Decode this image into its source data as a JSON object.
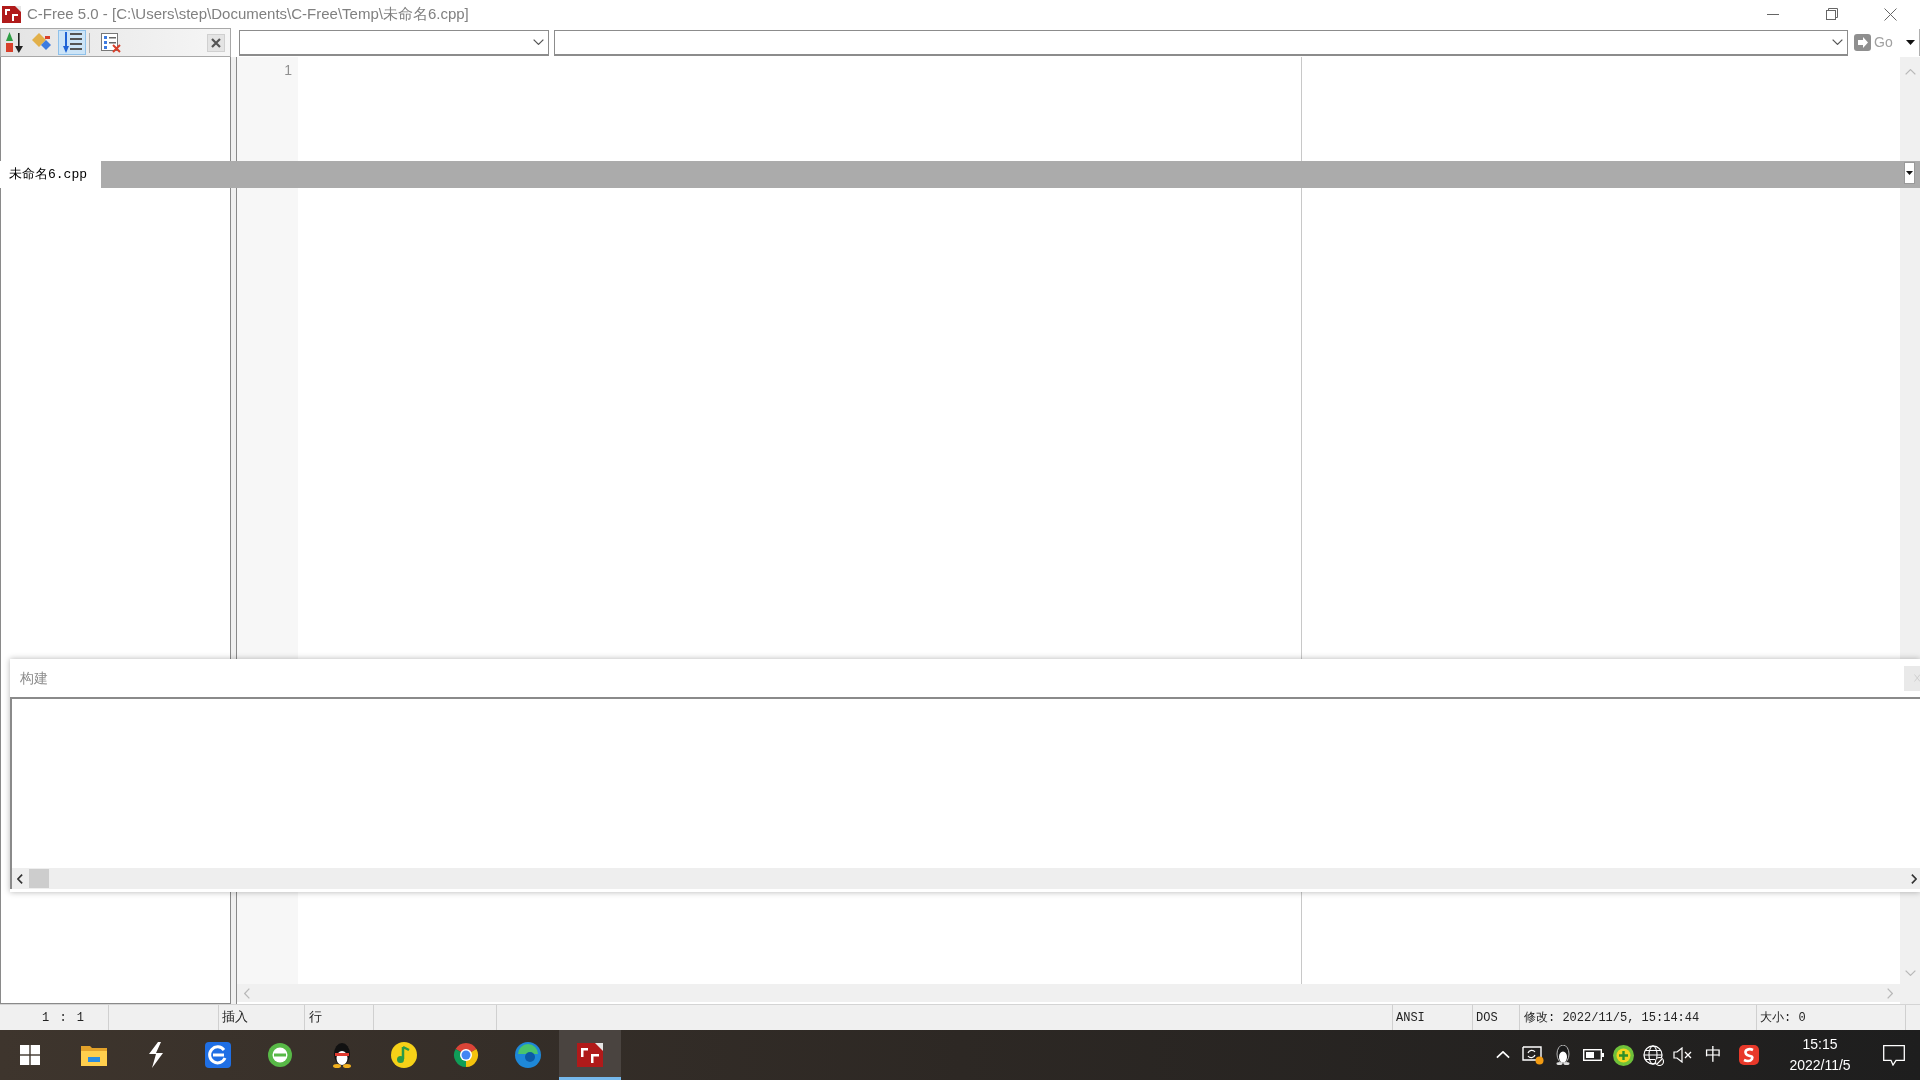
{
  "window": {
    "title": "C-Free 5.0 - [C:\\Users\\step\\Documents\\C-Free\\Temp\\未命名6.cpp]"
  },
  "class_view": {
    "toolbar": [
      {
        "kind": "sort",
        "selected": false
      },
      {
        "kind": "tags",
        "selected": false
      },
      {
        "kind": "outline",
        "selected": true
      },
      {
        "kind": "options",
        "selected": false
      }
    ]
  },
  "toolbar": {
    "go_button": {
      "label": "Go",
      "disabled": true
    }
  },
  "editor": {
    "line_numbers": [
      "1"
    ]
  },
  "document_tabs": [
    {
      "label": "未命名6.cpp",
      "selected": true
    }
  ],
  "build_panel": {
    "title": "构建"
  },
  "status_bar": {
    "cursor": "1 : 1",
    "mode": "插入",
    "unit": "行",
    "encoding": "ANSI",
    "line_ending": "DOS",
    "modified": "修改: 2022/11/5, 15:14:44",
    "size": "大小: 0"
  },
  "taskbar": {
    "apps": [
      {
        "kind": "folder",
        "active": false
      },
      {
        "kind": "bolt",
        "active": false
      },
      {
        "kind": "tile",
        "active": false
      },
      {
        "kind": "ring",
        "active": false
      },
      {
        "kind": "penguin",
        "active": false
      },
      {
        "kind": "note",
        "active": false
      },
      {
        "kind": "wheel",
        "active": false
      },
      {
        "kind": "swirl",
        "active": false
      },
      {
        "kind": "logo",
        "active": true
      }
    ],
    "tray": {
      "input_method": "中",
      "time": "15:15",
      "date": "2022/11/5"
    }
  }
}
